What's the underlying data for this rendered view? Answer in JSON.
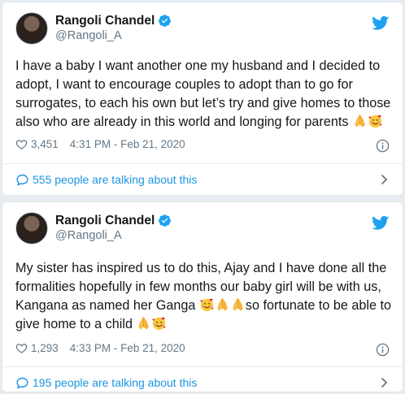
{
  "colors": {
    "accent": "#1da1f2",
    "link": "#1b95e0",
    "text": "#14171a",
    "muted": "#657786"
  },
  "tweets": [
    {
      "name": "Rangoli Chandel",
      "handle": "@Rangoli_A",
      "text": "I have a baby I want another one my husband and I decided to adopt, I want to encourage couples to adopt than to go for surrogates, to each his own but let’s try and give homes to those also who are already in this world and longing for parents",
      "likes": "3,451",
      "timestamp": "4:31 PM - Feb 21, 2020",
      "talking": "555 people are talking about this"
    },
    {
      "name": "Rangoli Chandel",
      "handle": "@Rangoli_A",
      "text_part1": "My sister has inspired us to do this, Ajay and I have done all the formalities hopefully in few months our baby girl will be with us, Kangana as named her Ganga",
      "text_part2": "so fortunate to be able to give home to a child",
      "likes": "1,293",
      "timestamp": "4:33 PM - Feb 21, 2020",
      "talking": "195 people are talking about this"
    }
  ],
  "icons": [
    "avatar",
    "verified-badge-icon",
    "twitter-bird-icon",
    "heart-icon",
    "info-icon",
    "speech-bubble-icon",
    "chevron-right-icon",
    "folded-hands-emoji",
    "smiling-hearts-emoji"
  ]
}
